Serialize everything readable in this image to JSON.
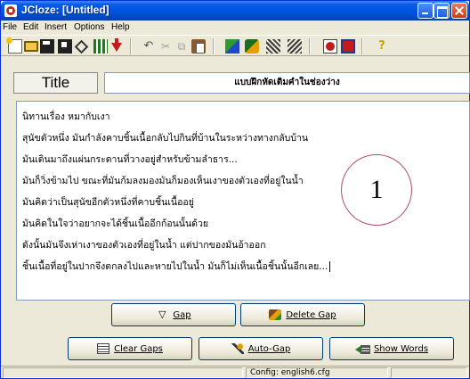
{
  "window": {
    "title": "JCloze: [Untitled]"
  },
  "menu": {
    "items": [
      "File",
      "Edit",
      "Insert",
      "Options",
      "Help"
    ]
  },
  "toolbar": {
    "icons": [
      "new-file-icon",
      "open-folder-icon",
      "save-icon",
      "save-as-icon",
      "diamond-icon",
      "grid-icon",
      "down-arrow-icon",
      "undo-icon",
      "cut-icon",
      "copy-icon",
      "paste-icon",
      "web-page-icon",
      "export-icon",
      "gap-list-icon",
      "settings-icon",
      "add-icon",
      "delete-icon",
      "help-icon"
    ],
    "undo_glyph": "↶",
    "cut_glyph": "✂",
    "copy_glyph": "⧉",
    "help_glyph": "?"
  },
  "title_row": {
    "label": "Title",
    "value": "แบบฝึกหัดเติมคำในช่องว่าง"
  },
  "editor": {
    "lines": [
      "นิทานเรื่อง หมากับเงา",
      "สุนัขตัวหนึ่ง มันกำลังคาบชิ้นเนื้อกลับไปกินที่บ้านในระหว่างทางกลับบ้าน",
      "มันเดินมาถึงแผ่นกระดานที่วางอยู่สำหรับข้ามลำธาร...",
      "มันก็วิ่งข้ามไป ขณะที่มันก้มลงมองมันก็มองเห็นเงาของตัวเองที่อยู่ในน้ำ",
      "มันคิดว่าเป็นสุนัขอีกตัวหนึ่งที่คาบชิ้นเนื้ออยู่",
      "มันคิดในใจว่าอยากจะได้ชิ้นเนื้ออีกก้อนนั้นด้วย",
      "ดังนั้นมันจึงเห่าเงาของตัวเองที่อยู่ในน้ำ แต่ปากของมันอ้าออก",
      "ชิ้นเนื้อที่อยู่ในปากจึงตกลงไปและหายไปในน้ำ มันก็ไม่เห็นเนื้อชิ้นนั้นอีกเลย..."
    ],
    "badge": "1"
  },
  "buttons": {
    "gap": {
      "label": "Gap",
      "icon_glyph": "▽"
    },
    "delete_gap": {
      "label": "Delete Gap"
    },
    "clear_gaps": {
      "label": "Clear Gaps"
    },
    "auto_gap": {
      "label": "Auto-Gap"
    },
    "show_words": {
      "label": "Show Words"
    }
  },
  "status": {
    "config": "Config: english6.cfg"
  },
  "colors": {
    "titlebar": "#0054E3",
    "window_bg": "#ECE9D8",
    "badge_border": "#B24A6A"
  }
}
